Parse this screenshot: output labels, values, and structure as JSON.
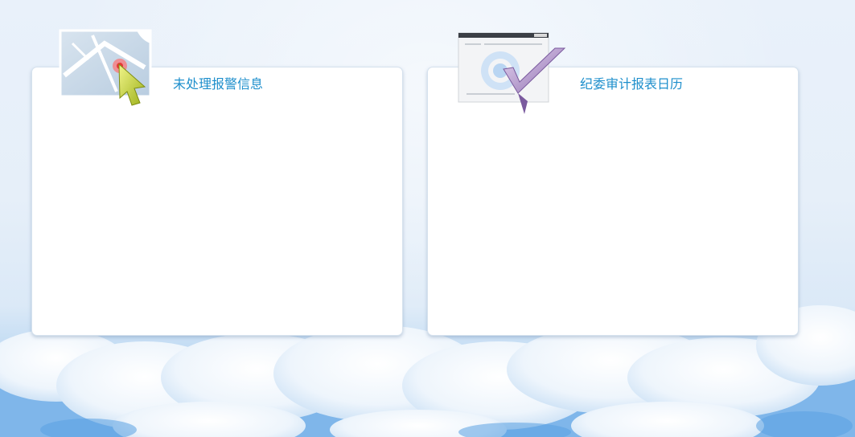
{
  "panels": {
    "left": {
      "title": "未处理报警信息",
      "icon": "map-pin-icon"
    },
    "right": {
      "title": "纪委审计报表日历",
      "icon": "checkmark-report-icon"
    }
  },
  "colors": {
    "title": "#1e8fcc",
    "panel_bg": "#ffffff",
    "sky_top": "#e9f1fa",
    "sky_bottom": "#8fc0ec"
  }
}
